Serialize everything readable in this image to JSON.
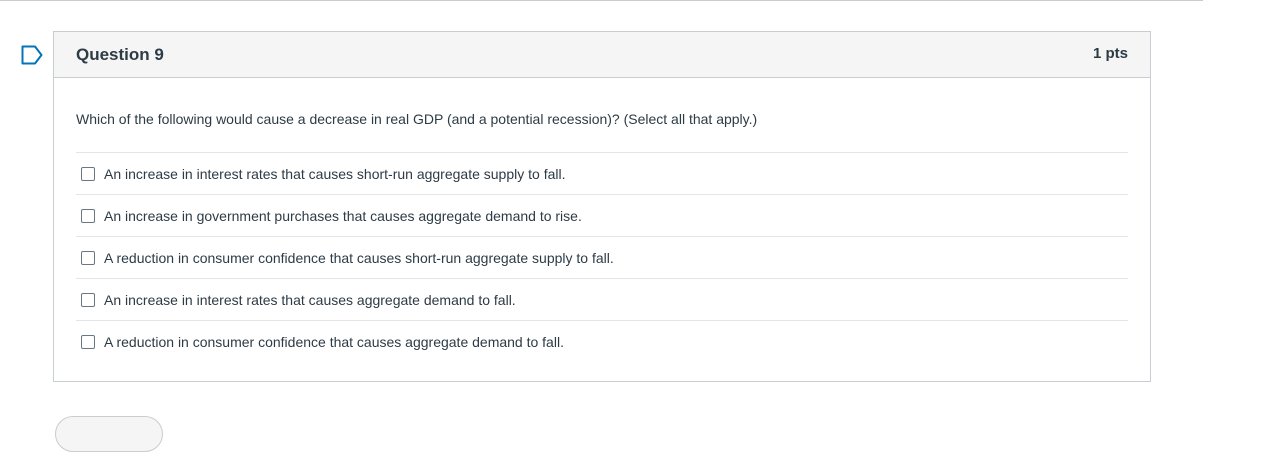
{
  "question": {
    "title": "Question 9",
    "points": "1 pts",
    "text": "Which of the following would cause a decrease in real GDP (and a potential recession)? (Select all that apply.)",
    "answers": [
      {
        "label": "An increase in interest rates that causes short-run aggregate supply to fall.",
        "checked": false
      },
      {
        "label": "An increase in government purchases that causes aggregate demand to rise.",
        "checked": false
      },
      {
        "label": "A reduction in consumer confidence that causes short-run aggregate supply to fall.",
        "checked": false
      },
      {
        "label": "An increase in interest rates that causes aggregate demand to fall.",
        "checked": false
      },
      {
        "label": "A reduction in consumer confidence that causes aggregate demand to fall.",
        "checked": false
      }
    ]
  },
  "icons": {
    "flag": "bookmark-flag-icon"
  },
  "colors": {
    "flag": "#0374b5",
    "text": "#2d3b45",
    "border": "#c7cdd1",
    "header_bg": "#f5f5f5"
  }
}
